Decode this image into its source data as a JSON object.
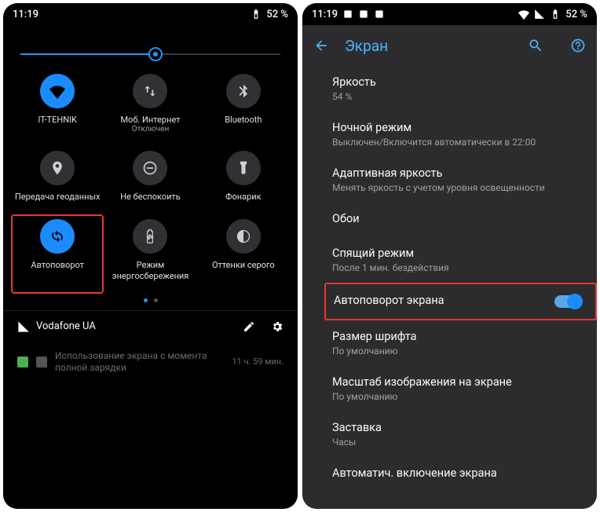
{
  "left": {
    "status": {
      "time": "11:19",
      "battery": "52 %"
    },
    "tiles": [
      {
        "name": "wifi",
        "label": "IT-TEHNIK",
        "sub": "",
        "active": true
      },
      {
        "name": "data",
        "label": "Моб. Интернет",
        "sub": "Отключен",
        "active": false
      },
      {
        "name": "bluetooth",
        "label": "Bluetooth",
        "sub": "",
        "active": false
      },
      {
        "name": "location",
        "label": "Передача геоданных",
        "sub": "",
        "active": false
      },
      {
        "name": "dnd",
        "label": "Не беспокоить",
        "sub": "",
        "active": false
      },
      {
        "name": "flashlight",
        "label": "Фонарик",
        "sub": "",
        "active": false
      },
      {
        "name": "rotate",
        "label": "Автоповорот",
        "sub": "",
        "active": true,
        "highlighted": true
      },
      {
        "name": "battery",
        "label": "Режим энергосбережения",
        "sub": "",
        "active": false
      },
      {
        "name": "grayscale",
        "label": "Оттенки серого",
        "sub": "",
        "active": false
      }
    ],
    "carrier": "Vodafone UA",
    "notif_text": "Использование экрана с момента полной зарядки",
    "notif_time": "11 ч. 59 мин."
  },
  "right": {
    "status": {
      "time": "11:19",
      "battery": "52 %"
    },
    "title": "Экран",
    "items": [
      {
        "title": "Яркость",
        "sub": "54 %"
      },
      {
        "title": "Ночной режим",
        "sub": "Выключен/Включится автоматически в 22:00"
      },
      {
        "title": "Адаптивная яркость",
        "sub": "Менять яркость с учетом уровня освещенности"
      },
      {
        "title": "Обои",
        "sub": ""
      },
      {
        "title": "Спящий режим",
        "sub": "После 1 мин. бездействия"
      },
      {
        "title": "Автоповорот экрана",
        "sub": "",
        "toggle": true,
        "highlighted": true
      },
      {
        "title": "Размер шрифта",
        "sub": "По умолчанию"
      },
      {
        "title": "Масштаб изображения на экране",
        "sub": "По умолчанию"
      },
      {
        "title": "Заставка",
        "sub": "Часы"
      },
      {
        "title": "Автоматич. включение экрана",
        "sub": ""
      }
    ]
  }
}
